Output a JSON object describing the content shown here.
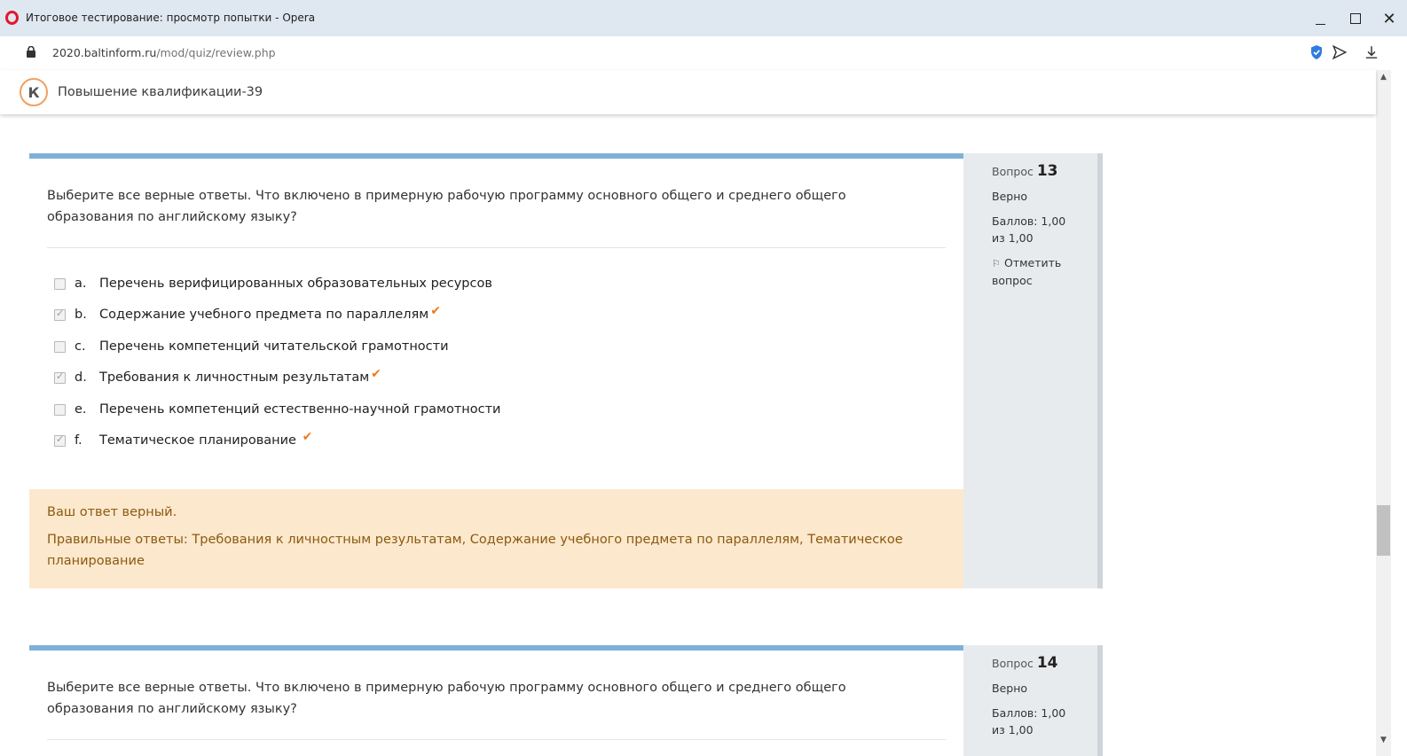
{
  "window": {
    "title": "Итоговое тестирование: просмотр попытки - Opera",
    "minimize_label": "minimize",
    "maximize_label": "maximize",
    "close_label": "✕"
  },
  "address": {
    "domain": "2020.baltinform.ru",
    "path": "/mod/quiz/review.php"
  },
  "site": {
    "name": "Повышение квалификации-39",
    "logo_letter": "К"
  },
  "questions": [
    {
      "num_label": "Вопрос",
      "num": "13",
      "status": "Верно",
      "score": "Баллов: 1,00 из 1,00",
      "flag_label": "Отметить вопрос",
      "text": "Выберите все верные ответы. Что включено в примерную рабочую программу основного общего и среднего общего образования по английскому языку?",
      "answers": [
        {
          "letter": "a.",
          "text": "Перечень верифицированных образовательных ресурсов",
          "checked": false,
          "correct": false
        },
        {
          "letter": "b.",
          "text": "Содержание учебного предмета по параллелям",
          "checked": true,
          "correct": true
        },
        {
          "letter": "c.",
          "text": "Перечень компетенций читательской грамотности",
          "checked": false,
          "correct": false
        },
        {
          "letter": "d.",
          "text": "Требования к личностным результатам",
          "checked": true,
          "correct": true
        },
        {
          "letter": "e.",
          "text": "Перечень компетенций естественно-научной грамотности",
          "checked": false,
          "correct": false
        },
        {
          "letter": "f.",
          "text": "Тематическое планирование ",
          "checked": true,
          "correct": true
        }
      ],
      "feedback": "Ваш ответ верный.",
      "right_answer": "Правильные ответы: Требования к личностным результатам, Содержание учебного предмета по параллелям, Тематическое планирование"
    },
    {
      "num_label": "Вопрос",
      "num": "14",
      "status": "Верно",
      "score": "Баллов: 1,00 из 1,00",
      "text": "Выберите все верные ответы. Что включено в примерную рабочую программу основного общего и среднего общего образования по английскому языку?"
    }
  ],
  "colors": {
    "accent": "#7eb1d7",
    "tick": "#f0791c",
    "feedback_bg": "#fce8cc",
    "feedback_text": "#8a5a12"
  }
}
